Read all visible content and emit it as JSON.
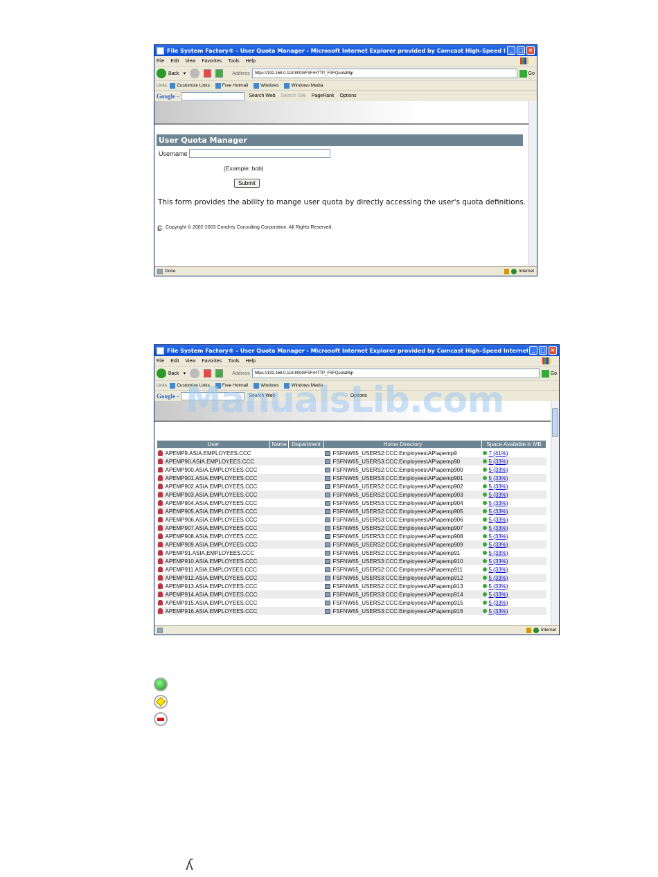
{
  "window1": {
    "title": "File System Factory® - User Quota Manager - Microsoft Internet Explorer provided by Comcast High-Speed Internet",
    "menu": [
      "File",
      "Edit",
      "View",
      "Favorites",
      "Tools",
      "Help"
    ],
    "toolbar": {
      "back": "Back",
      "address_label": "Address",
      "address": "https://192.168.0.118:8009/FSF/HTTP_FSFQuotaMgr",
      "go": "Go"
    },
    "links_label": "Links",
    "links": [
      "Customize Links",
      "Free Hotmail",
      "Windows",
      "Windows Media"
    ],
    "google": {
      "logo": "Google -",
      "items": [
        "Search Web",
        "Search Site",
        "PageRank",
        "Options"
      ]
    },
    "page": {
      "heading": "User Quota Manager",
      "username_label": "Username",
      "example": "(Example: bob)",
      "submit": "Submit",
      "description": "This form provides the ability to mange user quota by directly accessing the user's quota definitions.",
      "copyright": "Copyright © 2002-2003 Condrey Consulting Corporation. All Rights Reserved."
    },
    "status": {
      "text": "Done",
      "zone": "Internet"
    }
  },
  "window2": {
    "title": "File System Factory® - User Quota Manager - Microsoft Internet Explorer provided by Comcast High-Speed Internet",
    "menu": [
      "File",
      "Edit",
      "View",
      "Favorites",
      "Tools",
      "Help"
    ],
    "toolbar": {
      "back": "Back",
      "address_label": "Address",
      "address": "https://192.168.0.118:8009/FSF/HTTP_FSFQuotaMgr",
      "go": "Go"
    },
    "links_label": "Links",
    "links": [
      "Customize Links",
      "Free Hotmail",
      "Windows",
      "Windows Media"
    ],
    "google": {
      "logo": "Google -",
      "items": [
        "Search Web",
        "Options"
      ]
    },
    "table": {
      "headers": [
        "User",
        "Name",
        "Department",
        "Home Directory",
        "Space Available in MB"
      ],
      "rows": [
        {
          "user": "APEMP9.ASIA.EMPLOYEES.CCC",
          "home": "FSFNW65_USERS2:CCC:Employees\\AP\\apemp9",
          "space": "7 (41%)"
        },
        {
          "user": "APEMP90.ASIA.EMPLOYEES.CCC",
          "home": "FSFNW65_USERS3:CCC:Employees\\AP\\apemp90",
          "space": "5 (33%)"
        },
        {
          "user": "APEMP900.ASIA.EMPLOYEES.CCC",
          "home": "FSFNW65_USERS2:CCC:Employees\\AP\\apemp900",
          "space": "5 (33%)"
        },
        {
          "user": "APEMP901.ASIA.EMPLOYEES.CCC",
          "home": "FSFNW65_USERS3:CCC:Employees\\AP\\apemp901",
          "space": "5 (33%)"
        },
        {
          "user": "APEMP902.ASIA.EMPLOYEES.CCC",
          "home": "FSFNW65_USERS2:CCC:Employees\\AP\\apemp902",
          "space": "5 (33%)"
        },
        {
          "user": "APEMP903.ASIA.EMPLOYEES.CCC",
          "home": "FSFNW65_USERS2:CCC:Employees\\AP\\apemp903",
          "space": "5 (33%)"
        },
        {
          "user": "APEMP904.ASIA.EMPLOYEES.CCC",
          "home": "FSFNW65_USERS3:CCC:Employees\\AP\\apemp904",
          "space": "5 (33%)"
        },
        {
          "user": "APEMP905.ASIA.EMPLOYEES.CCC",
          "home": "FSFNW65_USERS2:CCC:Employees\\AP\\apemp905",
          "space": "5 (33%)"
        },
        {
          "user": "APEMP906.ASIA.EMPLOYEES.CCC",
          "home": "FSFNW65_USERS3:CCC:Employees\\AP\\apemp906",
          "space": "5 (33%)"
        },
        {
          "user": "APEMP907.ASIA.EMPLOYEES.CCC",
          "home": "FSFNW65_USERS2:CCC:Employees\\AP\\apemp907",
          "space": "5 (33%)"
        },
        {
          "user": "APEMP908.ASIA.EMPLOYEES.CCC",
          "home": "FSFNW65_USERS3:CCC:Employees\\AP\\apemp908",
          "space": "5 (33%)"
        },
        {
          "user": "APEMP909.ASIA.EMPLOYEES.CCC",
          "home": "FSFNW65_USERS2:CCC:Employees\\AP\\apemp909",
          "space": "5 (33%)"
        },
        {
          "user": "APEMP91.ASIA.EMPLOYEES.CCC",
          "home": "FSFNW65_USERS2:CCC:Employees\\AP\\apemp91",
          "space": "5 (33%)"
        },
        {
          "user": "APEMP910.ASIA.EMPLOYEES.CCC",
          "home": "FSFNW65_USERS3:CCC:Employees\\AP\\apemp910",
          "space": "5 (33%)"
        },
        {
          "user": "APEMP911.ASIA.EMPLOYEES.CCC",
          "home": "FSFNW65_USERS2:CCC:Employees\\AP\\apemp911",
          "space": "5 (33%)"
        },
        {
          "user": "APEMP912.ASIA.EMPLOYEES.CCC",
          "home": "FSFNW65_USERS3:CCC:Employees\\AP\\apemp912",
          "space": "5 (33%)"
        },
        {
          "user": "APEMP913.ASIA.EMPLOYEES.CCC",
          "home": "FSFNW65_USERS2:CCC:Employees\\AP\\apemp913",
          "space": "5 (33%)"
        },
        {
          "user": "APEMP914.ASIA.EMPLOYEES.CCC",
          "home": "FSFNW65_USERS3:CCC:Employees\\AP\\apemp914",
          "space": "5 (33%)"
        },
        {
          "user": "APEMP915.ASIA.EMPLOYEES.CCC",
          "home": "FSFNW65_USERS2:CCC:Employees\\AP\\apemp915",
          "space": "5 (33%)"
        },
        {
          "user": "APEMP916.ASIA.EMPLOYEES.CCC",
          "home": "FSFNW65_USERS3:CCC:Employees\\AP\\apemp916",
          "space": "5 (33%)"
        }
      ]
    },
    "status": {
      "zone": "Internet"
    }
  },
  "watermark": "ManualsLib.com",
  "legend_icons": [
    "green-status-icon",
    "yellow-warning-icon",
    "red-stop-icon"
  ],
  "colors": {
    "header_bg": "#6d8593",
    "titlebar": "#0a4bd6",
    "link": "#0000cc"
  }
}
